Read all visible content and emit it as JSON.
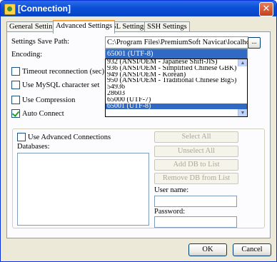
{
  "window": {
    "title": "[Connection]",
    "close_glyph": "✕"
  },
  "tabs": [
    {
      "label": "General Settings"
    },
    {
      "label": "Advanced Settings"
    },
    {
      "label": "SSL Settings"
    },
    {
      "label": "SSH Settings"
    }
  ],
  "settings": {
    "save_path_label": "Settings Save Path:",
    "save_path_value": "C:\\Program Files\\PremiumSoft Navicat\\localhost",
    "browse_label": "...",
    "encoding_label": "Encoding:",
    "encoding_selected": "65001 (UTF-8)",
    "encoding_options": [
      "932   (ANSI/OEM - Japanese Shift-JIS)",
      "936   (ANSI/OEM - Simplified Chinese GBK)",
      "949   (ANSI/OEM - Korean)",
      "950   (ANSI/OEM - Traditional Chinese Big5)",
      "54936",
      "28603",
      "65000 (UTF-7)",
      "65001 (UTF-8)"
    ],
    "timeout_label": "Timeout reconnection (sec):",
    "mysql_charset_label": "Use MySQL character set",
    "compression_label": "Use Compression",
    "auto_connect_label": "Auto Connect",
    "auto_connect_checked": true
  },
  "advanced": {
    "use_advanced_label": "Use Advanced Connections",
    "databases_label": "Databases:",
    "select_all": "Select All",
    "unselect_all": "Unselect All",
    "add_db": "Add DB to List",
    "remove_db": "Remove DB from List",
    "user_name_label": "User name:",
    "password_label": "Password:"
  },
  "footer": {
    "ok": "OK",
    "cancel": "Cancel"
  }
}
